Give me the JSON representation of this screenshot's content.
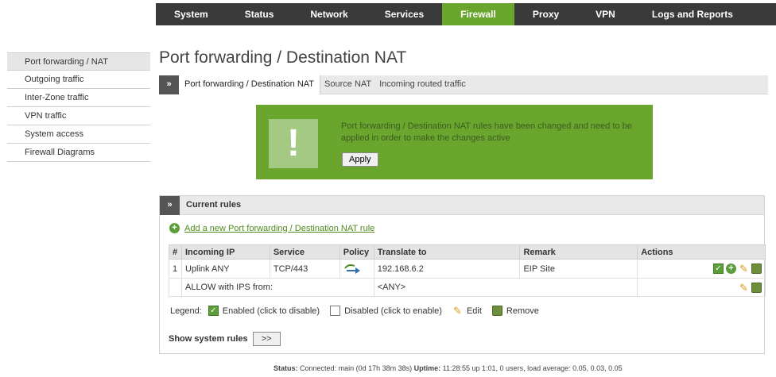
{
  "topnav": [
    {
      "label": "System"
    },
    {
      "label": "Status"
    },
    {
      "label": "Network"
    },
    {
      "label": "Services"
    },
    {
      "label": "Firewall",
      "active": true
    },
    {
      "label": "Proxy"
    },
    {
      "label": "VPN"
    },
    {
      "label": "Logs and Reports"
    }
  ],
  "sidebar": [
    {
      "label": "Port forwarding / NAT",
      "active": true
    },
    {
      "label": "Outgoing traffic"
    },
    {
      "label": "Inter-Zone traffic"
    },
    {
      "label": "VPN traffic"
    },
    {
      "label": "System access"
    },
    {
      "label": "Firewall Diagrams"
    }
  ],
  "page": {
    "title": "Port forwarding / Destination NAT"
  },
  "tabs": [
    {
      "label": "Port forwarding / Destination NAT",
      "active": true
    },
    {
      "label": "Source NAT"
    },
    {
      "label": "Incoming routed traffic"
    }
  ],
  "chevron": "»",
  "notice": {
    "icon": "!",
    "message": "Port forwarding / Destination NAT rules have been changed and need to be applied in order to make the changes active",
    "apply_label": "Apply"
  },
  "rules": {
    "title": "Current rules",
    "add_link": "Add a new Port forwarding / Destination NAT rule",
    "columns": [
      "#",
      "Incoming IP",
      "Service",
      "Policy",
      "Translate to",
      "Remark",
      "Actions"
    ],
    "row": {
      "num": "1",
      "incoming_ip": "Uplink ANY",
      "service": "TCP/443",
      "translate_to": "192.168.6.2",
      "remark": "EIP Site"
    },
    "subrow": {
      "allow": "ALLOW with IPS from:",
      "any": "<ANY>"
    }
  },
  "legend": {
    "label": "Legend:",
    "enabled": "Enabled (click to disable)",
    "disabled": "Disabled (click to enable)",
    "edit": "Edit",
    "remove": "Remove"
  },
  "show_system": {
    "label": "Show system rules",
    "button": ">>"
  },
  "status": {
    "status_label": "Status:",
    "status_value": "Connected: main (0d 17h 38m 38s)",
    "uptime_label": "Uptime:",
    "uptime_value": "11:28:55 up 1:01, 0 users, load average: 0.05, 0.03, 0.05"
  },
  "colors": {
    "accent_green": "#6aa52e",
    "nav_dark": "#3a3a3a",
    "link_green": "#4e8a1f",
    "red_text": "#a3141c"
  }
}
